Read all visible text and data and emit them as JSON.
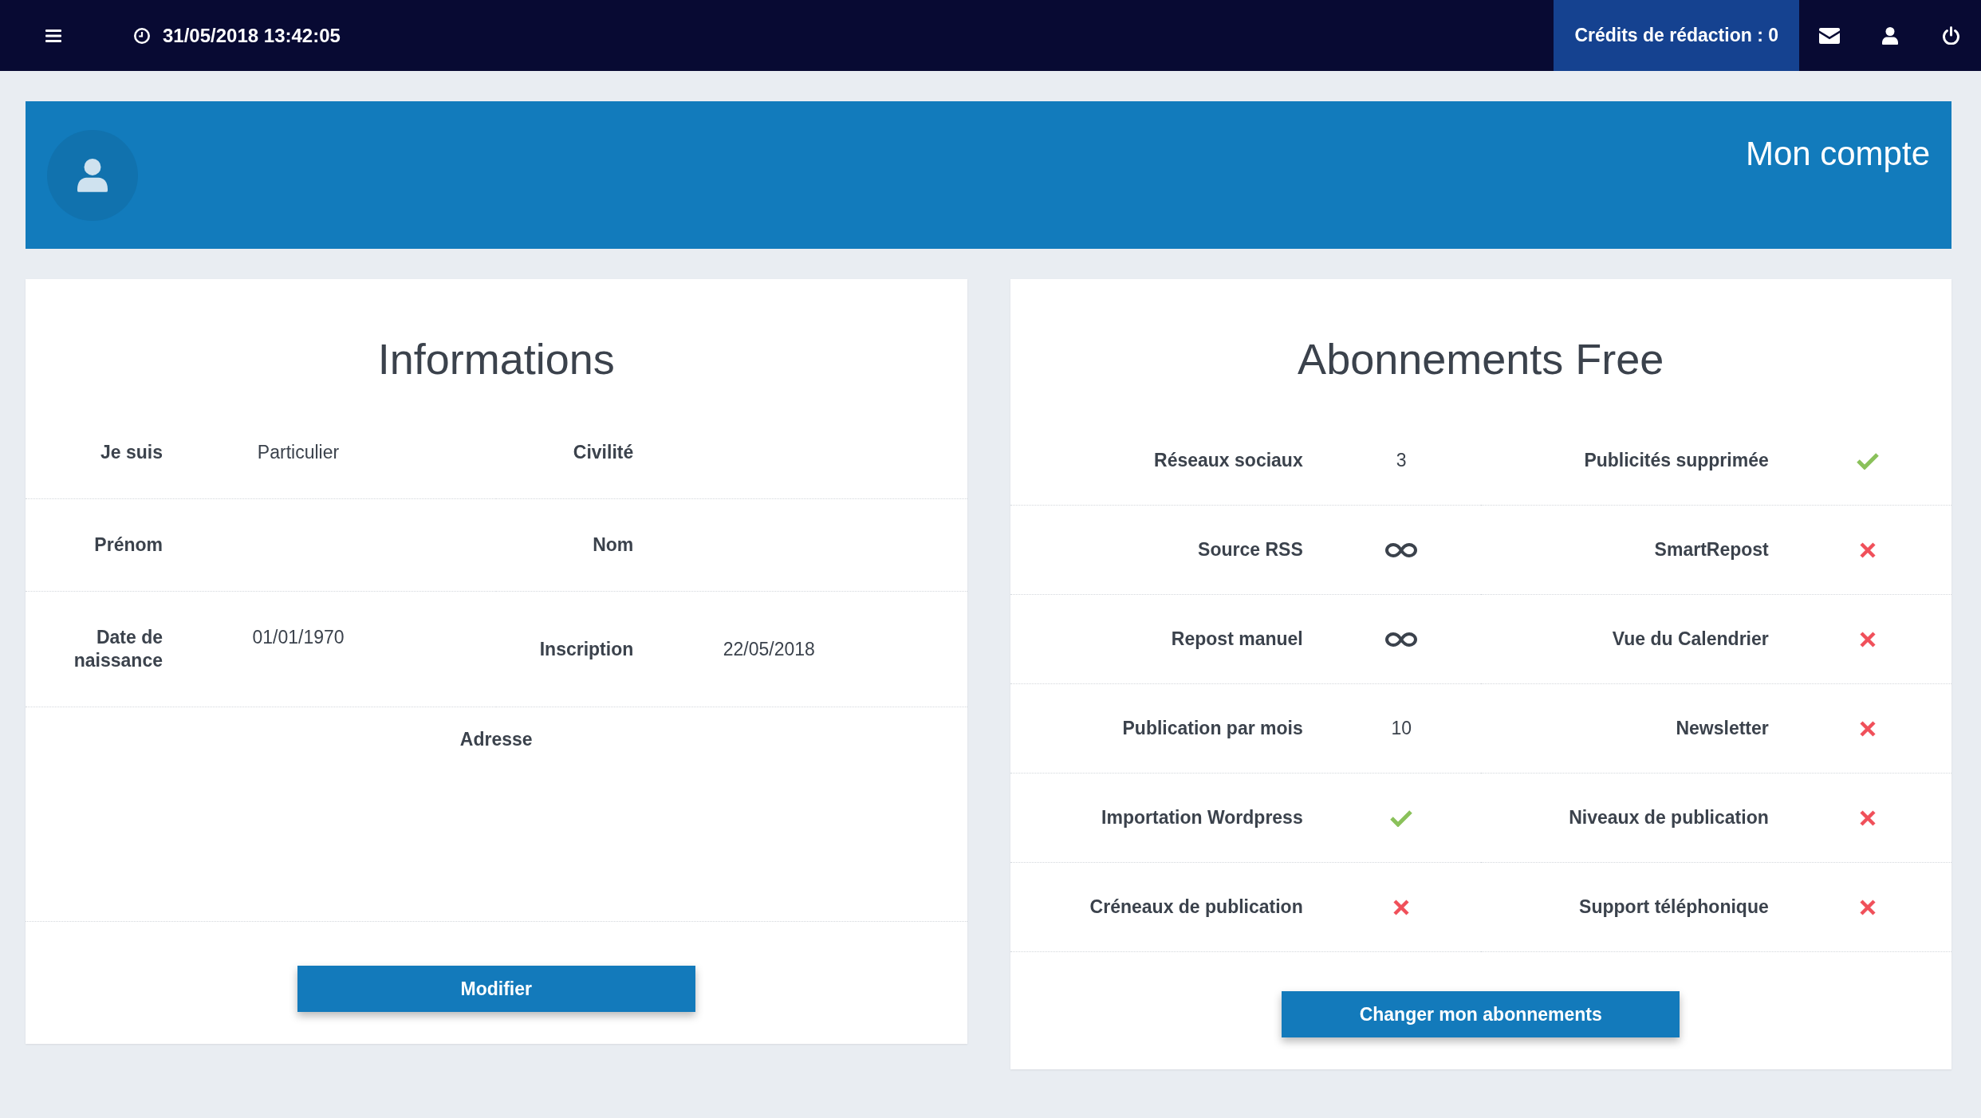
{
  "top_bar": {
    "date_time": "31/05/2018 13:42:05",
    "credits": "Crédits de rédaction : 0"
  },
  "header": {
    "title": "Mon compte"
  },
  "informations": {
    "title": "Informations",
    "fields": [
      {
        "label": "Je suis",
        "value": "Particulier"
      },
      {
        "label": "Civilité"
      },
      {
        "label": "Prénom"
      },
      {
        "label": "Nom"
      },
      {
        "label": "Date de naissance",
        "value": "01/01/1970"
      },
      {
        "label": "Inscription",
        "value": "22/05/2018"
      }
    ],
    "address": {
      "label": "Adresse"
    },
    "button": "Modifier"
  },
  "subscription": {
    "title": "Abonnements Free",
    "features": [
      {
        "label": "Réseaux sociaux",
        "kind": "count",
        "value": "3"
      },
      {
        "label": "Publicités supprimée",
        "kind": "flag",
        "included": true
      },
      {
        "label": "Source RSS",
        "kind": "unlimited"
      },
      {
        "label": "SmartRepost",
        "kind": "flag",
        "included": false
      },
      {
        "label": "Repost manuel",
        "kind": "unlimited"
      },
      {
        "label": "Vue du Calendrier",
        "kind": "flag",
        "included": false
      },
      {
        "label": "Publication par mois",
        "kind": "count",
        "value": "10"
      },
      {
        "label": "Newsletter",
        "kind": "flag",
        "included": false
      },
      {
        "label": "Importation Wordpress",
        "kind": "flag",
        "included": true
      },
      {
        "label": "Niveaux de publication",
        "kind": "flag",
        "included": false
      },
      {
        "label": "Créneaux de publication",
        "kind": "flag",
        "included": false
      },
      {
        "label": "Support téléphonique",
        "kind": "flag",
        "included": false
      }
    ],
    "button": "Changer mon abonnements"
  }
}
